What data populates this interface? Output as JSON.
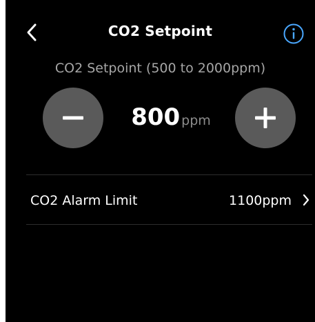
{
  "header": {
    "title": "CO2 Setpoint",
    "back_icon": "chevron-left-icon",
    "info_icon": "info-icon"
  },
  "setpoint": {
    "range_label": "CO2 Setpoint (500 to 2000ppm)",
    "value": "800",
    "unit": "ppm",
    "decrement_icon": "minus-icon",
    "increment_icon": "plus-icon"
  },
  "alarm_row": {
    "label": "CO2 Alarm Limit",
    "value": "1100ppm",
    "chevron_icon": "chevron-right-icon"
  },
  "colors": {
    "background": "#000000",
    "accent": "#4aa8ff",
    "stepper_button": "#5a5a5a",
    "muted_text": "#a6a6a6"
  }
}
